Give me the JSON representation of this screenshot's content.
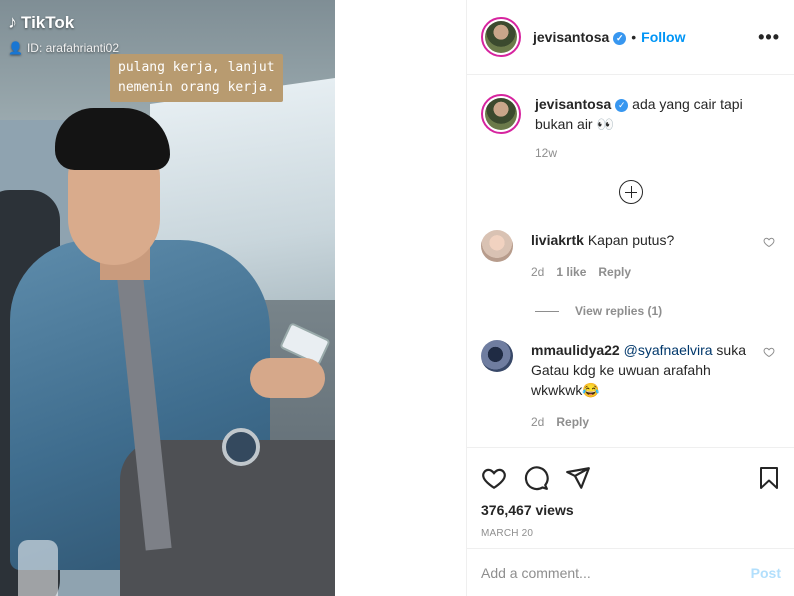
{
  "media": {
    "watermark": "TikTok",
    "tiktok_id": "ID: arafahrianti02",
    "caption_line1": "pulang kerja, lanjut",
    "caption_line2": "nemenin orang kerja."
  },
  "post": {
    "username": "jevisantosa",
    "separator": "•",
    "follow_label": "Follow",
    "more_label": "•••",
    "caption": "ada yang cair tapi bukan air 👀",
    "caption_time": "12w",
    "views": "376,467 views",
    "date": "MARCH 20"
  },
  "comments": [
    {
      "username": "liviakrtk",
      "text": "Kapan putus?",
      "time": "2d",
      "likes": "1 like",
      "reply_label": "Reply",
      "view_replies": "View replies (1)"
    },
    {
      "username": "mmaulidya22",
      "mention": "@syafnaelvira",
      "text": "suka Gatau kdg ke uwuan arafahh wkwkwk😂",
      "time": "2d",
      "reply_label": "Reply"
    }
  ],
  "add_comment": {
    "placeholder": "Add a comment...",
    "post_label": "Post"
  },
  "colors": {
    "follow_blue": "#0095f6",
    "verified_blue": "#3897f0",
    "post_disabled": "#b2dffc",
    "caption_bg": "#b89b70"
  }
}
